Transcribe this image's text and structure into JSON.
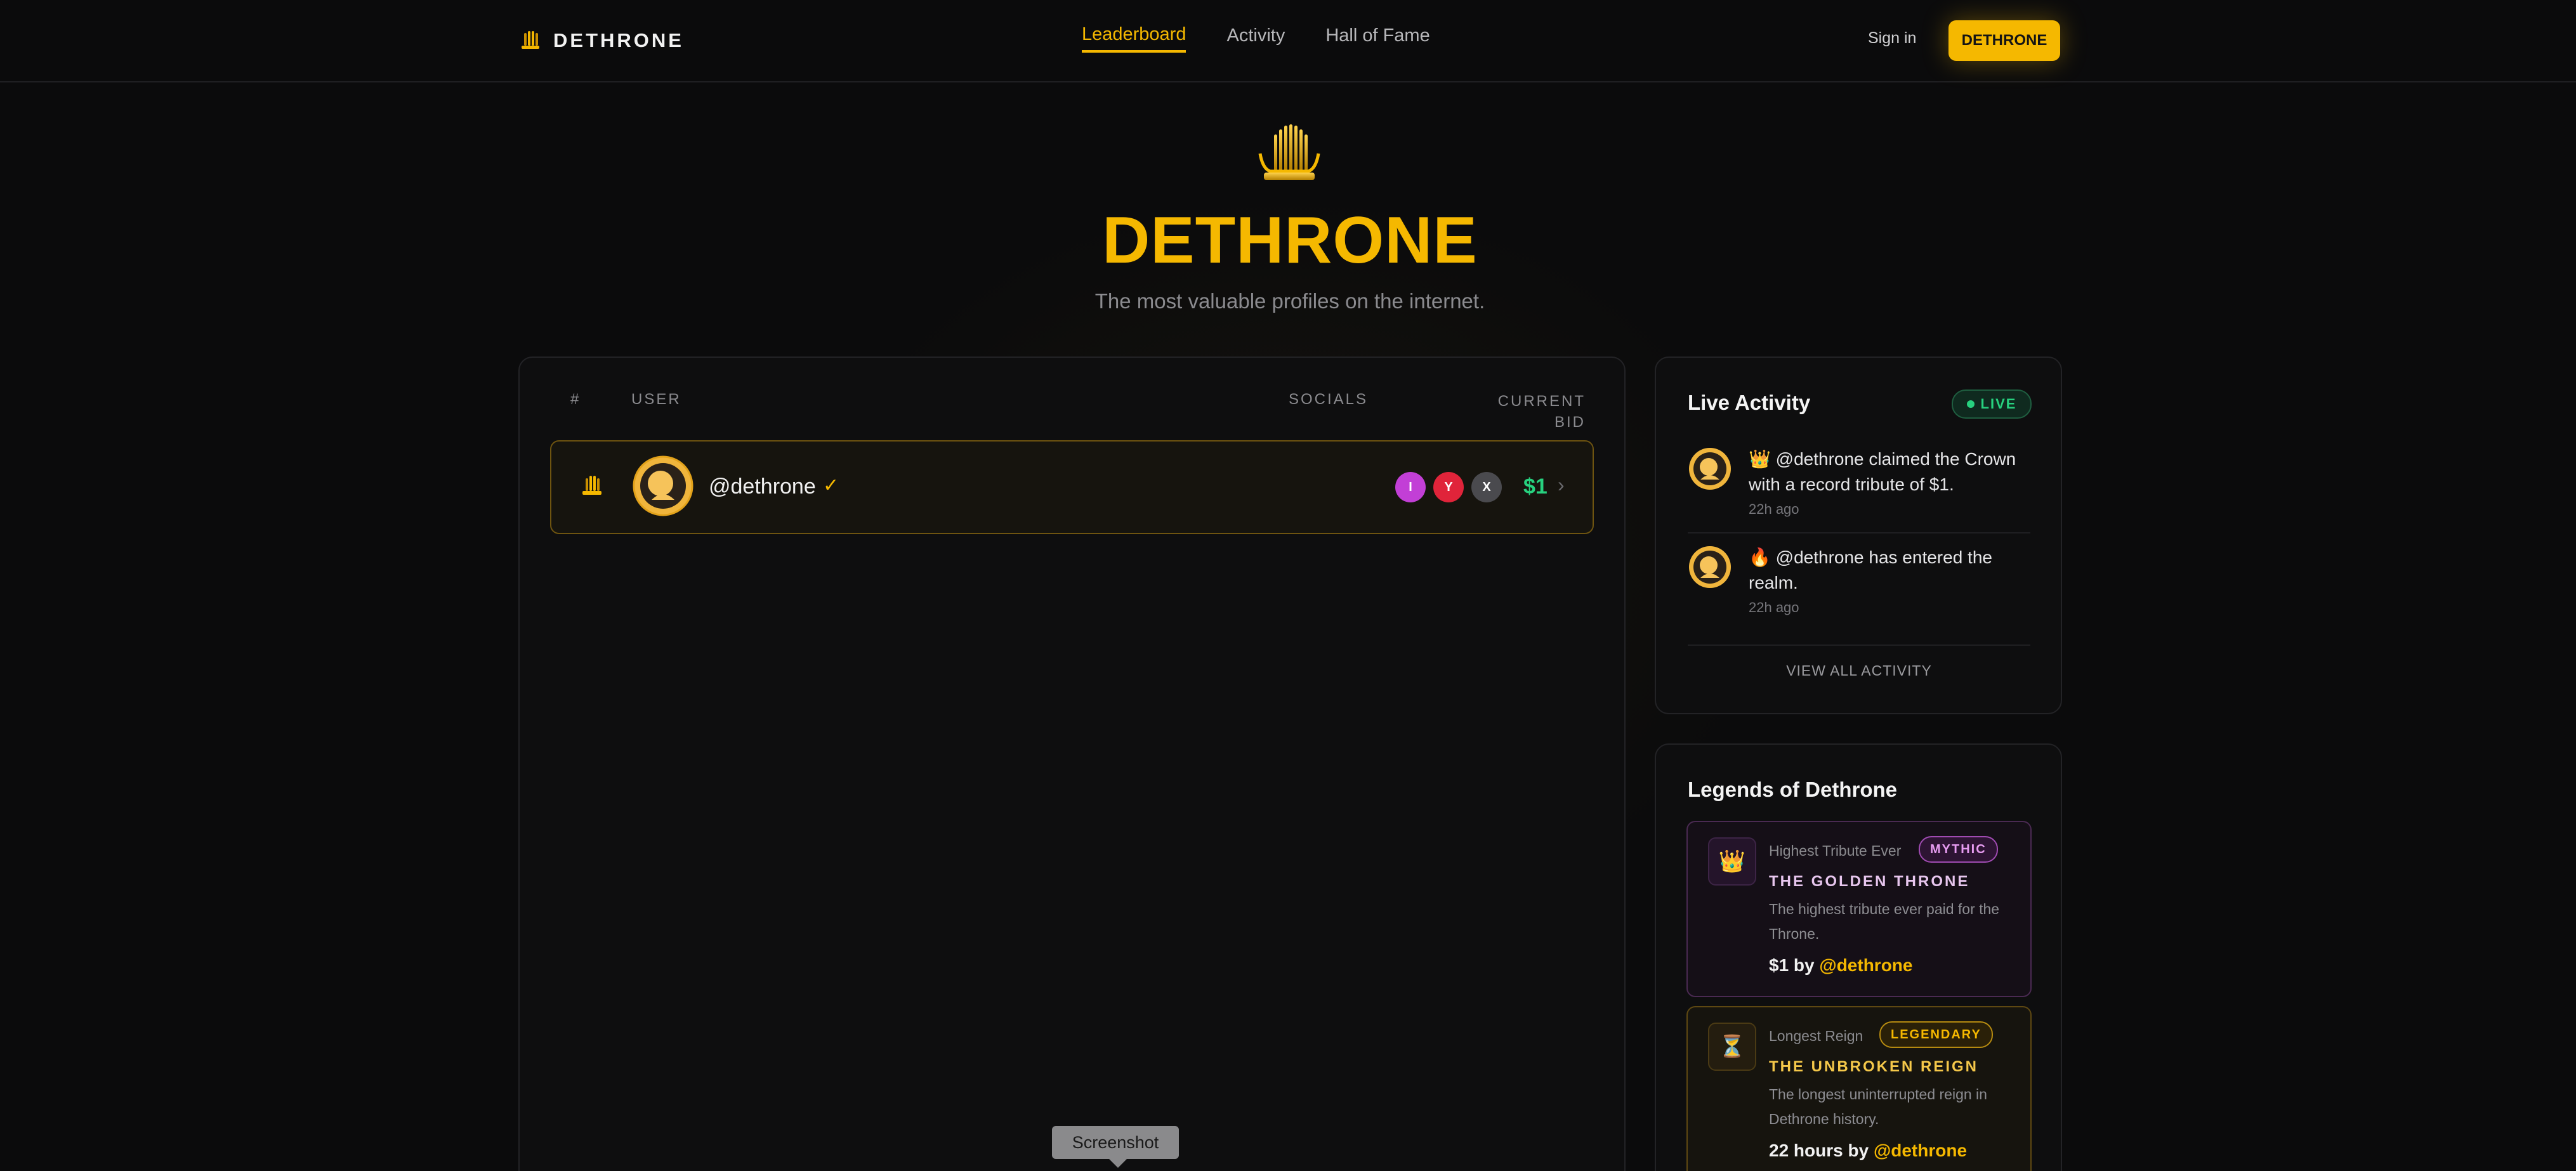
{
  "nav": {
    "brand": "DETHRONE",
    "links": [
      "Leaderboard",
      "Activity",
      "Hall of Fame"
    ],
    "signin": "Sign in",
    "cta": "DETHRONE"
  },
  "hero": {
    "title": "DETHRONE",
    "subtitle": "The most valuable profiles on the internet."
  },
  "leaderboard": {
    "headers": {
      "num": "#",
      "user": "USER",
      "socials": "SOCIALS",
      "bid": "CURRENT BID"
    },
    "rows": [
      {
        "username": "@dethrone",
        "verified": "✓",
        "socials": [
          "I",
          "Y",
          "X"
        ],
        "bid": "$1",
        "chevron": "›"
      }
    ]
  },
  "activity": {
    "title": "Live Activity",
    "live": "LIVE",
    "items": [
      {
        "text": "👑 @dethrone claimed the Crown with a record tribute of $1.",
        "time": "22h ago"
      },
      {
        "text": "🔥 @dethrone has entered the realm.",
        "time": "22h ago"
      }
    ],
    "view_all": "VIEW ALL ACTIVITY"
  },
  "legends": {
    "title": "Legends of Dethrone",
    "cards": [
      {
        "icon": "👑",
        "category": "Highest Tribute Ever",
        "badge": "MYTHIC",
        "name": "THE GOLDEN THRONE",
        "desc": "The highest tribute ever paid for the Throne.",
        "value": "$1 by ",
        "user": "@dethrone"
      },
      {
        "icon": "⏳",
        "category": "Longest Reign",
        "badge": "LEGENDARY",
        "name": "THE UNBROKEN REIGN",
        "desc": "The longest uninterrupted reign in Dethrone history.",
        "value": "22 hours by ",
        "user": "@dethrone"
      }
    ]
  },
  "tooltip": "Screenshot",
  "colors": {
    "accent": "#f5b800",
    "bid": "#27d17f",
    "mythic": "#e79cf1"
  }
}
